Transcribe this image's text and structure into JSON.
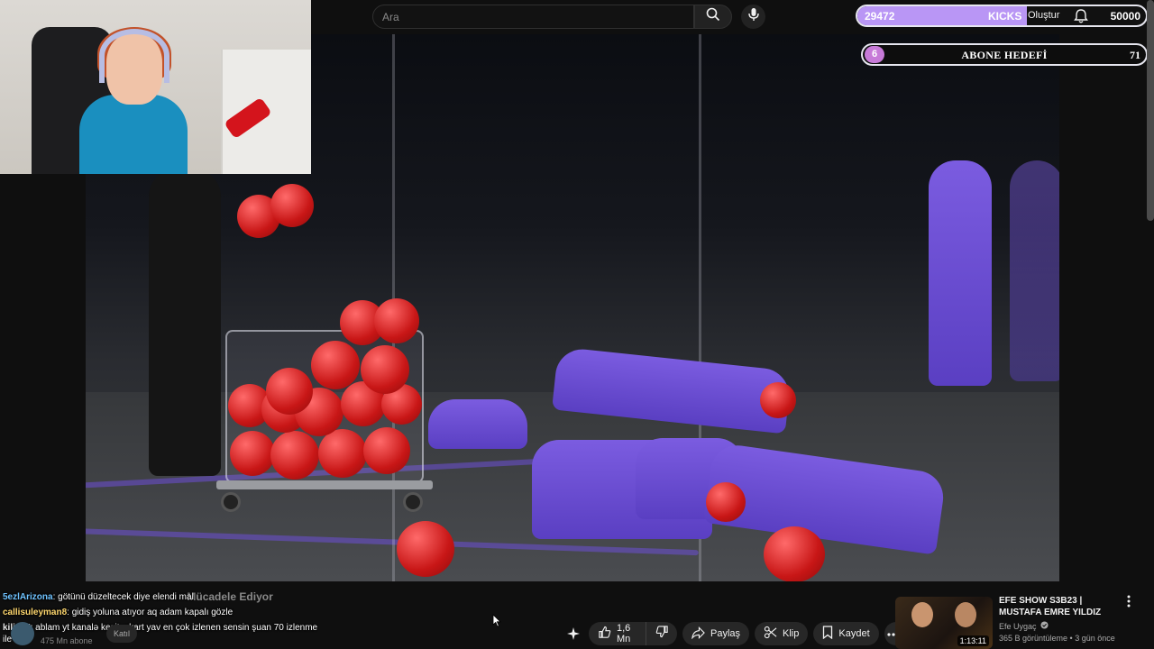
{
  "search": {
    "placeholder": "Ara"
  },
  "header": {
    "create_label": "Oluştur"
  },
  "kicks_widget": {
    "current": "29472",
    "label": "KICKS",
    "goal": "50000",
    "progress": 0.589
  },
  "sub_goal_widget": {
    "current": "6",
    "label": "ABONE HEDEFİ",
    "goal": "71"
  },
  "video": {
    "title_fragment": "Mücadele Ediyor"
  },
  "chat": [
    {
      "user": "5ezlArizona",
      "message": ": götünü düzeltecek diye elendi mal"
    },
    {
      "user": "callisuleyman8",
      "message": ": gidiş yoluna atıyor aq adam kapalı gözle"
    },
    {
      "user": "kilic47",
      "message": ": ablam yt kanalə kesit çıkart yav en çok izlenen sensin şuan 70 izlenme ile"
    }
  ],
  "channel": {
    "subscribers": "475 Mn abone",
    "join_label": "Katıl"
  },
  "actions": {
    "likes": "1,6 Mn",
    "share_label": "Paylaş",
    "clip_label": "Klip",
    "save_label": "Kaydet"
  },
  "recommendation": {
    "title": "EFE SHOW S3B23 | MUSTAFA EMRE YILDIZ",
    "channel": "Efe Uygaç",
    "meta": "365 B görüntüleme • 3 gün önce",
    "duration": "1:13:11"
  },
  "colors": {
    "kicks_fill": "#b996f5",
    "sub_dot": "#c77ad8",
    "accent": "#6b4fd6"
  }
}
